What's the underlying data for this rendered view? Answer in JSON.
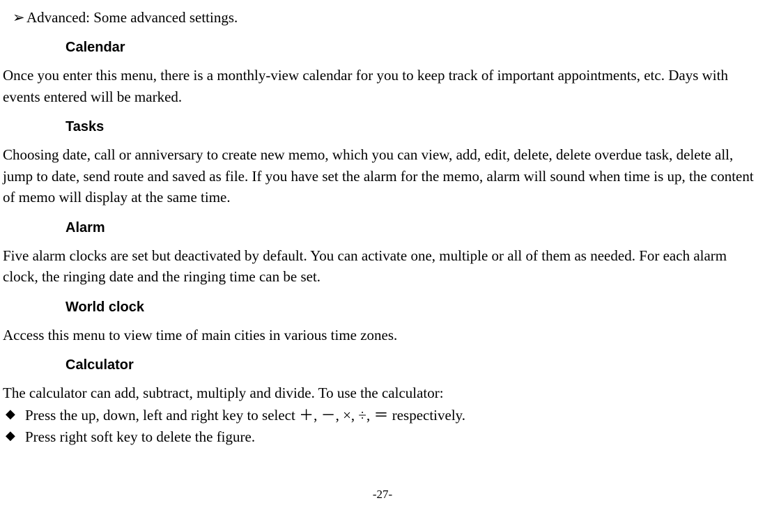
{
  "line_advanced": "Advanced: Some advanced settings.",
  "heading_calendar": "Calendar",
  "para_calendar": "Once you enter this menu, there is a monthly-view calendar for you to keep track of important appointments, etc. Days with events entered will be marked.",
  "heading_tasks": "Tasks",
  "para_tasks": "Choosing date, call or anniversary to create new memo, which you can view, add, edit, delete, delete overdue task, delete all, jump to date, send route and saved as file. If you have set the alarm for the memo, alarm will sound when time is up, the content of memo will display at the same time.",
  "heading_alarm": "Alarm",
  "para_alarm": "Five alarm clocks are set but deactivated by default. You can activate one, multiple or all of them as needed. For each alarm clock, the ringing date and the ringing time can be set.",
  "heading_world_clock": "World clock",
  "para_world_clock": "Access this menu to view time of main cities in various time zones.",
  "heading_calculator": "Calculator",
  "para_calculator_intro": "The calculator can add, subtract, multiply and divide. To use the calculator:",
  "bullet_calc_1": "Press the up, down, left and right key to select  ＋,  －, ×, ÷,  ＝  respectively.",
  "bullet_calc_2": "Press right soft key to delete the figure.",
  "page_number": "-27-"
}
